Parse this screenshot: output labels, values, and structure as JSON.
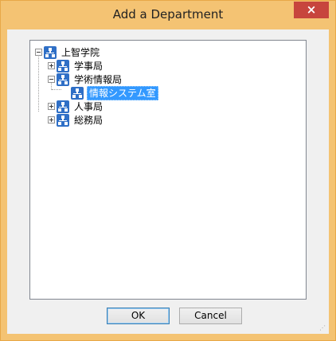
{
  "window": {
    "title": "Add a Department",
    "close_glyph": "×"
  },
  "tree": {
    "root": {
      "label": "上智学院",
      "expanded": true
    },
    "children": [
      {
        "label": "学事局",
        "expanded": false
      },
      {
        "label": "学術情報局",
        "expanded": true,
        "children": [
          {
            "label": "情報システム室",
            "selected": true
          }
        ]
      },
      {
        "label": "人事局",
        "expanded": false
      },
      {
        "label": "総務局",
        "expanded": false
      }
    ]
  },
  "buttons": {
    "ok_label": "OK",
    "cancel_label": "Cancel"
  },
  "icons": {
    "department": "org-chart-icon",
    "expand": "plus-expander-icon",
    "collapse": "minus-expander-icon",
    "resize": "resize-grip-icon"
  },
  "colors": {
    "titlebar": "#f4c373",
    "close_button": "#c7453d",
    "selection": "#3399ff",
    "icon_blue": "#2f6fc6"
  }
}
